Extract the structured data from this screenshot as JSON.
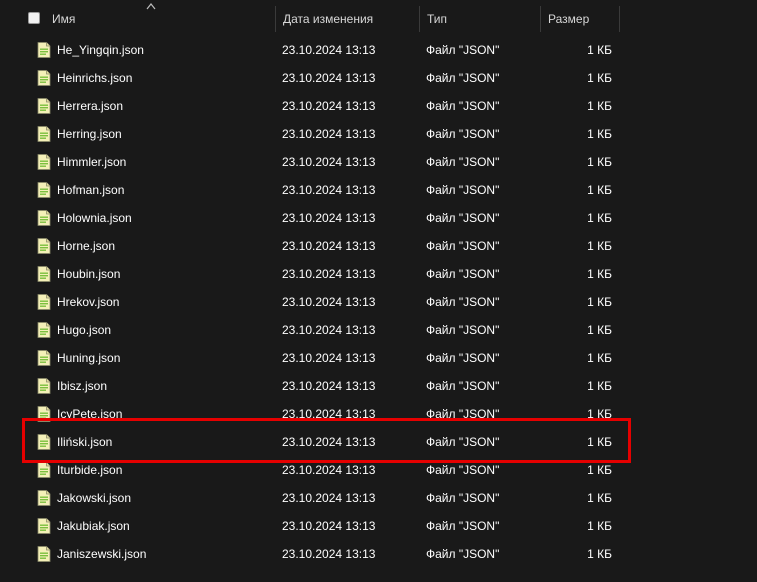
{
  "columns": {
    "name": "Имя",
    "date": "Дата изменения",
    "type": "Тип",
    "size": "Размер"
  },
  "icons": {
    "file": "json-file-icon",
    "sort": "sort-ascending-icon"
  },
  "colors": {
    "background": "#191919",
    "highlight": "#e60000",
    "icon_body": "#f4f0b8",
    "icon_accent": "#7bbf3f"
  },
  "files": [
    {
      "name": "He_Yingqin.json",
      "date": "23.10.2024 13:13",
      "type": "Файл \"JSON\"",
      "size": "1 КБ"
    },
    {
      "name": "Heinrichs.json",
      "date": "23.10.2024 13:13",
      "type": "Файл \"JSON\"",
      "size": "1 КБ"
    },
    {
      "name": "Herrera.json",
      "date": "23.10.2024 13:13",
      "type": "Файл \"JSON\"",
      "size": "1 КБ"
    },
    {
      "name": "Herring.json",
      "date": "23.10.2024 13:13",
      "type": "Файл \"JSON\"",
      "size": "1 КБ"
    },
    {
      "name": "Himmler.json",
      "date": "23.10.2024 13:13",
      "type": "Файл \"JSON\"",
      "size": "1 КБ"
    },
    {
      "name": "Hofman.json",
      "date": "23.10.2024 13:13",
      "type": "Файл \"JSON\"",
      "size": "1 КБ"
    },
    {
      "name": "Holownia.json",
      "date": "23.10.2024 13:13",
      "type": "Файл \"JSON\"",
      "size": "1 КБ"
    },
    {
      "name": "Horne.json",
      "date": "23.10.2024 13:13",
      "type": "Файл \"JSON\"",
      "size": "1 КБ"
    },
    {
      "name": "Houbin.json",
      "date": "23.10.2024 13:13",
      "type": "Файл \"JSON\"",
      "size": "1 КБ"
    },
    {
      "name": "Hrekov.json",
      "date": "23.10.2024 13:13",
      "type": "Файл \"JSON\"",
      "size": "1 КБ"
    },
    {
      "name": "Hugo.json",
      "date": "23.10.2024 13:13",
      "type": "Файл \"JSON\"",
      "size": "1 КБ"
    },
    {
      "name": "Huning.json",
      "date": "23.10.2024 13:13",
      "type": "Файл \"JSON\"",
      "size": "1 КБ"
    },
    {
      "name": "Ibisz.json",
      "date": "23.10.2024 13:13",
      "type": "Файл \"JSON\"",
      "size": "1 КБ"
    },
    {
      "name": "IcyPete.json",
      "date": "23.10.2024 13:13",
      "type": "Файл \"JSON\"",
      "size": "1 КБ"
    },
    {
      "name": "Iliński.json",
      "date": "23.10.2024 13:13",
      "type": "Файл \"JSON\"",
      "size": "1 КБ"
    },
    {
      "name": "Iturbide.json",
      "date": "23.10.2024 13:13",
      "type": "Файл \"JSON\"",
      "size": "1 КБ"
    },
    {
      "name": "Jakowski.json",
      "date": "23.10.2024 13:13",
      "type": "Файл \"JSON\"",
      "size": "1 КБ"
    },
    {
      "name": "Jakubiak.json",
      "date": "23.10.2024 13:13",
      "type": "Файл \"JSON\"",
      "size": "1 КБ"
    },
    {
      "name": "Janiszewski.json",
      "date": "23.10.2024 13:13",
      "type": "Файл \"JSON\"",
      "size": "1 КБ"
    }
  ]
}
